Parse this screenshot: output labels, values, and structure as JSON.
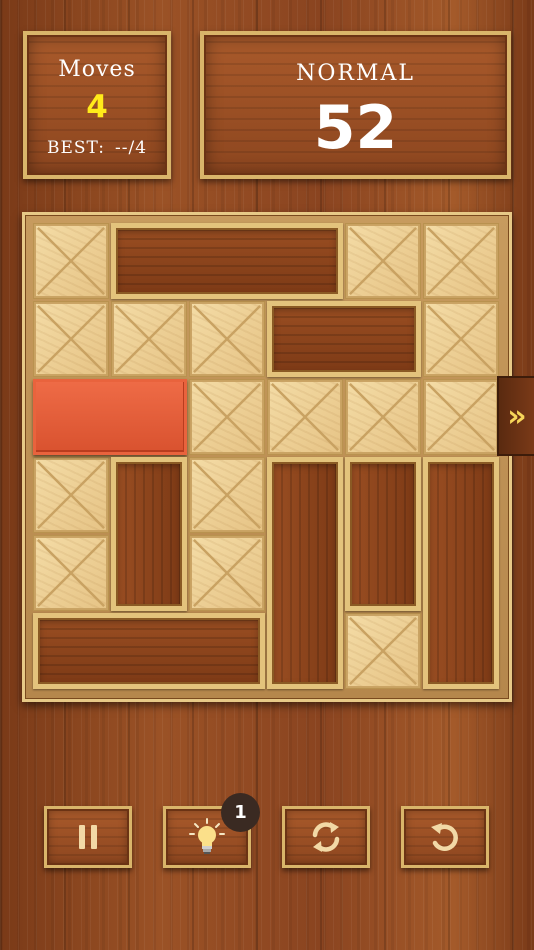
{
  "score_panel": {
    "moves_label": "Moves",
    "moves_value": "4",
    "best_label": "BEST:",
    "best_value": "--/4"
  },
  "level_panel": {
    "difficulty": "NORMAL",
    "level_number": "52"
  },
  "board": {
    "grid_size": 6,
    "target_row": 2,
    "blocks": [
      {
        "id": "h-top",
        "orientation": "horizontal",
        "row": 0,
        "col": 1,
        "length": 3
      },
      {
        "id": "h-upper-right",
        "orientation": "horizontal",
        "row": 1,
        "col": 3,
        "length": 2
      },
      {
        "id": "target",
        "orientation": "horizontal",
        "row": 2,
        "col": 0,
        "length": 2,
        "is_target": true
      },
      {
        "id": "v-left",
        "orientation": "vertical",
        "row": 3,
        "col": 1,
        "length": 2
      },
      {
        "id": "v-mid",
        "orientation": "vertical",
        "row": 3,
        "col": 3,
        "length": 3
      },
      {
        "id": "v-right-a",
        "orientation": "vertical",
        "row": 3,
        "col": 4,
        "length": 2
      },
      {
        "id": "v-right-b",
        "orientation": "vertical",
        "row": 3,
        "col": 5,
        "length": 3
      },
      {
        "id": "h-bottom",
        "orientation": "horizontal",
        "row": 5,
        "col": 0,
        "length": 3
      }
    ]
  },
  "exit_icon": "double-chevron-right-icon",
  "controls": {
    "pause_icon": "pause-icon",
    "hint_icon": "lightbulb-icon",
    "hint_count": "1",
    "restart_icon": "refresh-icon",
    "undo_icon": "undo-icon"
  },
  "colors": {
    "moves_value": "#ffeb1a",
    "target_block": "#e35c37",
    "frame_gold": "#d9b56a",
    "exit_arrow": "#f7d65a"
  }
}
